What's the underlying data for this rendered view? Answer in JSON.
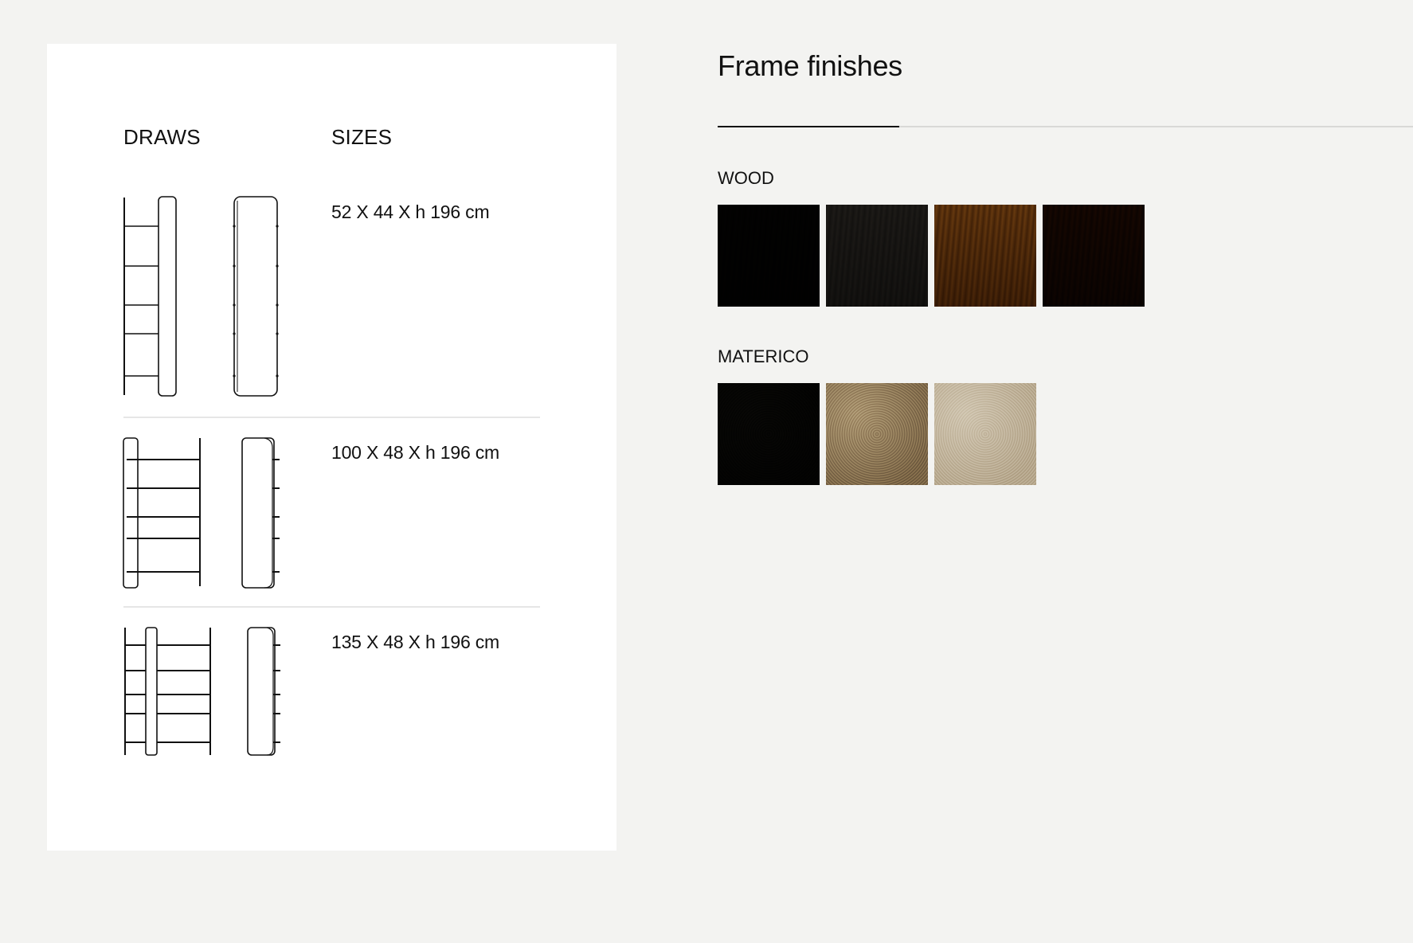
{
  "draws_header": "DRAWS",
  "sizes_header": "SIZES",
  "models": [
    {
      "size": "52 X 44 X h 196 cm"
    },
    {
      "size": "100 X 48 X h 196 cm"
    },
    {
      "size": "135 X 48 X h 196 cm"
    }
  ],
  "finishes": {
    "title": "Frame finishes",
    "groups": [
      {
        "name": "WOOD",
        "swatches": [
          {
            "icon": "black-wood-swatch",
            "colors": [
              "#0d0c0a",
              "#1c1a16"
            ]
          },
          {
            "icon": "grey-wood-swatch",
            "colors": [
              "#3b3936",
              "#57534e"
            ]
          },
          {
            "icon": "walnut-light-wood-swatch",
            "colors": [
              "#6d4a1f",
              "#a37a3f"
            ]
          },
          {
            "icon": "dark-walnut-wood-swatch",
            "colors": [
              "#2a170b",
              "#4d2c14"
            ]
          }
        ]
      },
      {
        "name": "MATERICO",
        "swatches": [
          {
            "icon": "black-materico-swatch",
            "colors": [
              "#0e0e0c",
              "#23221d"
            ]
          },
          {
            "icon": "bronze-materico-swatch",
            "colors": [
              "#6f6453",
              "#a39783"
            ]
          },
          {
            "icon": "sand-materico-swatch",
            "colors": [
              "#958b7c",
              "#b9b1a3"
            ]
          }
        ]
      }
    ]
  }
}
